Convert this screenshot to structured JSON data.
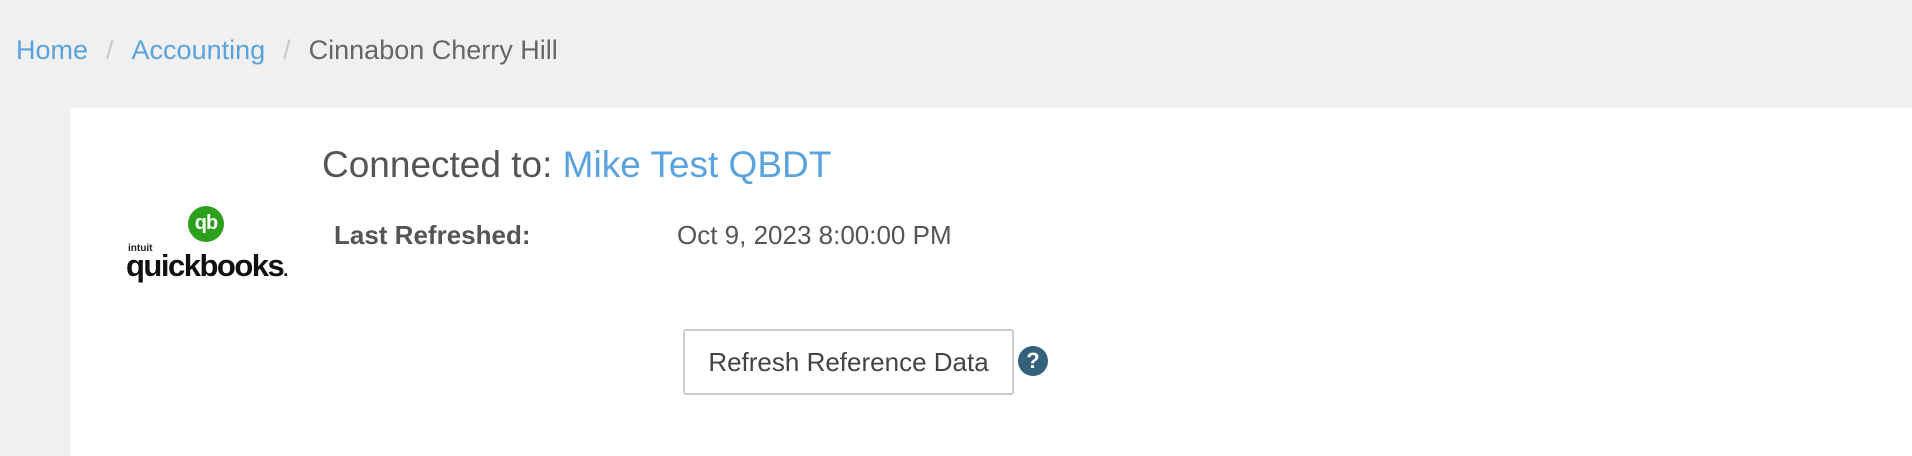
{
  "breadcrumb": {
    "items": [
      {
        "label": "Home"
      },
      {
        "label": "Accounting"
      },
      {
        "label": "Cinnabon Cherry Hill"
      }
    ],
    "separator": "/"
  },
  "connection": {
    "prefix": "Connected to:",
    "company": "Mike Test QBDT",
    "logo": {
      "icon": "quickbooks-qb-icon",
      "brand_small": "intuit",
      "wordmark": "quickbooks",
      "badge_glyph": "qb",
      "brand_color": "#2ca01c"
    }
  },
  "last_refreshed": {
    "label": "Last Refreshed:",
    "value": "Oct 9, 2023 8:00:00 PM"
  },
  "actions": {
    "refresh_button_label": "Refresh Reference Data",
    "help_icon": "question-circle-icon",
    "help_glyph": "?"
  },
  "colors": {
    "link": "#5aa3de",
    "page_background": "#f0f0f0",
    "panel_background": "#ffffff",
    "help_icon": "#35607a"
  }
}
